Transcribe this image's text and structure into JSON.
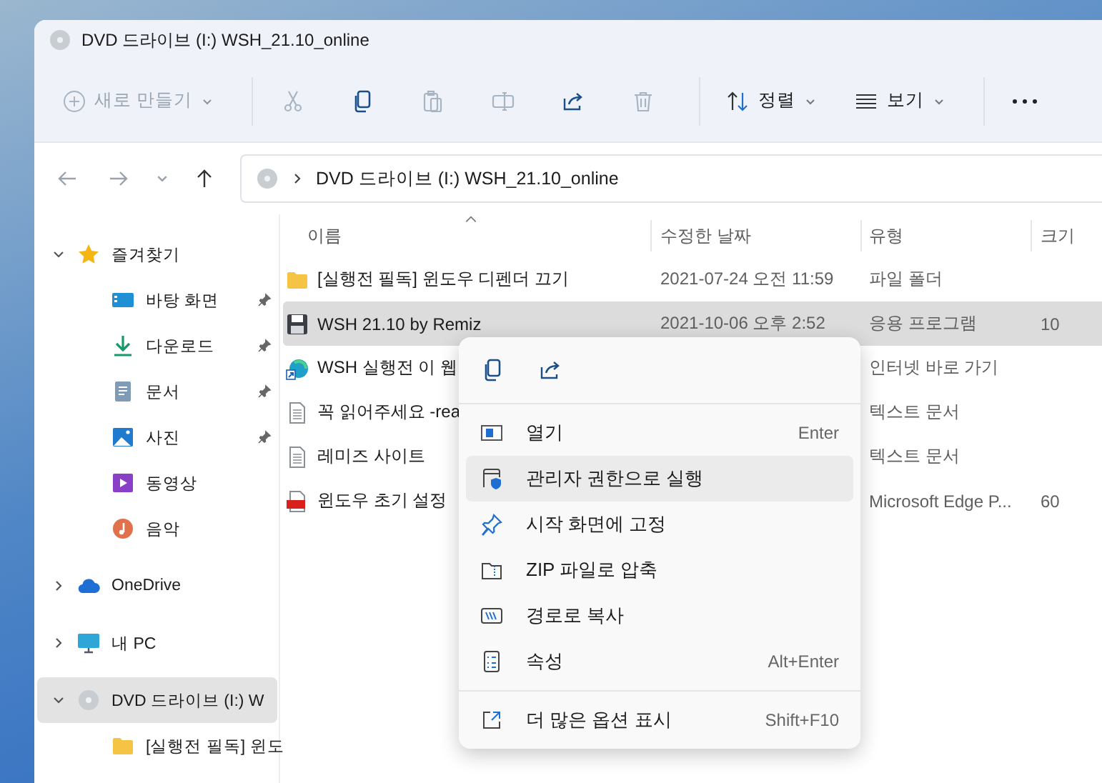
{
  "window": {
    "title": "DVD 드라이브 (I:) WSH_21.10_online"
  },
  "toolbar": {
    "new": {
      "label": "새로 만들기",
      "disabled": true
    },
    "actions": [
      {
        "kind": "cut",
        "disabled": true
      },
      {
        "kind": "copy",
        "disabled": false
      },
      {
        "kind": "paste",
        "disabled": true
      },
      {
        "kind": "rename",
        "disabled": true
      },
      {
        "kind": "share",
        "disabled": false
      },
      {
        "kind": "delete",
        "disabled": true
      }
    ],
    "sort": {
      "label": "정렬"
    },
    "view": {
      "label": "보기"
    }
  },
  "navigation": [
    {
      "kind": "back",
      "disabled": true
    },
    {
      "kind": "forward",
      "disabled": true
    },
    {
      "kind": "recent",
      "disabled": true
    },
    {
      "kind": "up",
      "disabled": false
    }
  ],
  "address_bar": {
    "path": "DVD 드라이브 (I:) WSH_21.10_online"
  },
  "sidebar": {
    "items": [
      {
        "kind": "star",
        "label": "즐겨찾기",
        "expanded": true,
        "selected": false,
        "children": [
          {
            "kind": "desktop",
            "label": "바탕 화면",
            "pinned": true,
            "selected": false
          },
          {
            "kind": "download",
            "label": "다운로드",
            "pinned": true,
            "selected": false
          },
          {
            "kind": "document",
            "label": "문서",
            "pinned": true,
            "selected": false
          },
          {
            "kind": "picture",
            "label": "사진",
            "pinned": true,
            "selected": false
          },
          {
            "kind": "video",
            "label": "동영상",
            "pinned": false,
            "selected": false
          },
          {
            "kind": "music",
            "label": "음악",
            "pinned": false,
            "selected": false
          }
        ]
      },
      {
        "kind": "cloud",
        "label": "OneDrive",
        "expanded": false,
        "selected": false
      },
      {
        "kind": "pc",
        "label": "내 PC",
        "expanded": false,
        "selected": false
      },
      {
        "kind": "disc",
        "label": "DVD 드라이브 (I:) W",
        "expanded": true,
        "selected": true,
        "children": [
          {
            "kind": "folder",
            "label": "[실행전 필독] 윈도",
            "selected": false
          }
        ]
      }
    ]
  },
  "file_list": {
    "columns": [
      {
        "label": "이름",
        "sorted": true
      },
      {
        "label": "수정한 날짜",
        "sorted": false
      },
      {
        "label": "유형",
        "sorted": false
      },
      {
        "label": "크기",
        "sorted": false
      }
    ],
    "rows": [
      {
        "kind": "folder",
        "name": "[실행전 필독] 윈도우 디펜더 끄기",
        "date": "2021-07-24 오전 11:59",
        "type": "파일 폴더",
        "selected": false
      },
      {
        "kind": "program",
        "name": "WSH 21.10 by Remiz",
        "date": "2021-10-06 오후 2:52",
        "type": "응용 프로그램",
        "size": "10",
        "selected": true
      },
      {
        "kind": "shortcut",
        "name": "WSH 실행전 이 웹",
        "type": "인터넷 바로 가기",
        "selected": false
      },
      {
        "kind": "text",
        "name": "꼭 읽어주세요 -rea",
        "type": "텍스트 문서",
        "selected": false
      },
      {
        "kind": "text",
        "name": "레미즈 사이트",
        "type": "텍스트 문서",
        "selected": false
      },
      {
        "kind": "pdf",
        "name": "윈도우 초기 설정",
        "type": "Microsoft Edge P...",
        "size": "60",
        "selected": false
      }
    ]
  },
  "context_menu": {
    "quick_actions": [
      {
        "kind": "copy"
      },
      {
        "kind": "share"
      }
    ],
    "items": [
      {
        "kind": "open",
        "label": "열기",
        "shortcut": "Enter",
        "selected": false
      },
      {
        "kind": "admin",
        "label": "관리자 권한으로 실행",
        "selected": true
      },
      {
        "kind": "pin",
        "label": "시작 화면에 고정",
        "selected": false
      },
      {
        "kind": "zip",
        "label": "ZIP 파일로 압축",
        "selected": false
      },
      {
        "kind": "path",
        "label": "경로로 복사",
        "selected": false
      },
      {
        "kind": "properties",
        "label": "속성",
        "shortcut": "Alt+Enter",
        "selected": false
      }
    ],
    "footer_items": [
      {
        "kind": "more",
        "label": "더 많은 옵션 표시",
        "shortcut": "Shift+F10",
        "selected": false
      }
    ]
  }
}
